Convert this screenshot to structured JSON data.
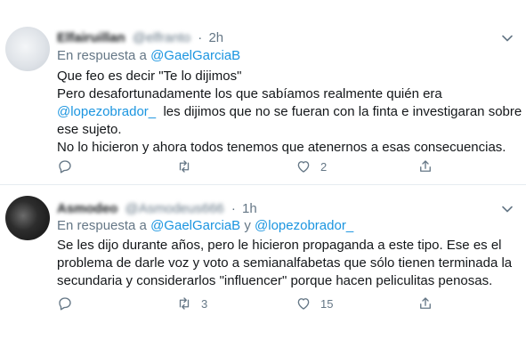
{
  "tweets": [
    {
      "author": "Elfairuillan",
      "handle": "@elfranto",
      "time": "2h",
      "reply_prefix": "En respuesta a",
      "reply_to": "@GaelGarciaB",
      "reply_joiner": "",
      "reply_to2": "",
      "lines": {
        "l1": "Que feo es decir \"Te lo dijimos\"",
        "l2": "Pero desafortunadamente los que sabíamos realmente quién era",
        "mention": "@lopezobrador_",
        "l3rest": "  les dijimos que no se fueran con la finta e investigaran sobre",
        "l4": "ese sujeto.",
        "l5": "No lo hicieron y ahora todos tenemos que atenernos a esas consecuencias."
      },
      "counts": {
        "replies": "",
        "retweets": "",
        "likes": "2"
      }
    },
    {
      "author": "Asmodeo",
      "handle": "@Asmodeus666",
      "time": "1h",
      "reply_prefix": "En respuesta a",
      "reply_to": "@GaelGarciaB",
      "reply_joiner": "y",
      "reply_to2": "@lopezobrador_",
      "lines": {
        "l1": "Se les dijo durante años, pero le hicieron propaganda a este tipo. Ese es el",
        "l2": "problema de darle voz y voto a semianalfabetas que sólo tienen terminada la",
        "l3": "secundaria y considerarlos \"influencer\" porque hacen peliculitas penosas."
      },
      "counts": {
        "replies": "",
        "retweets": "3",
        "likes": "15"
      }
    }
  ],
  "icons": [
    "caret-down-icon",
    "reply-icon",
    "retweet-icon",
    "like-icon",
    "share-icon"
  ],
  "colors": {
    "link": "#1b95e0",
    "secondary": "#657786",
    "text": "#14171a",
    "divider": "#e6ecf0"
  }
}
